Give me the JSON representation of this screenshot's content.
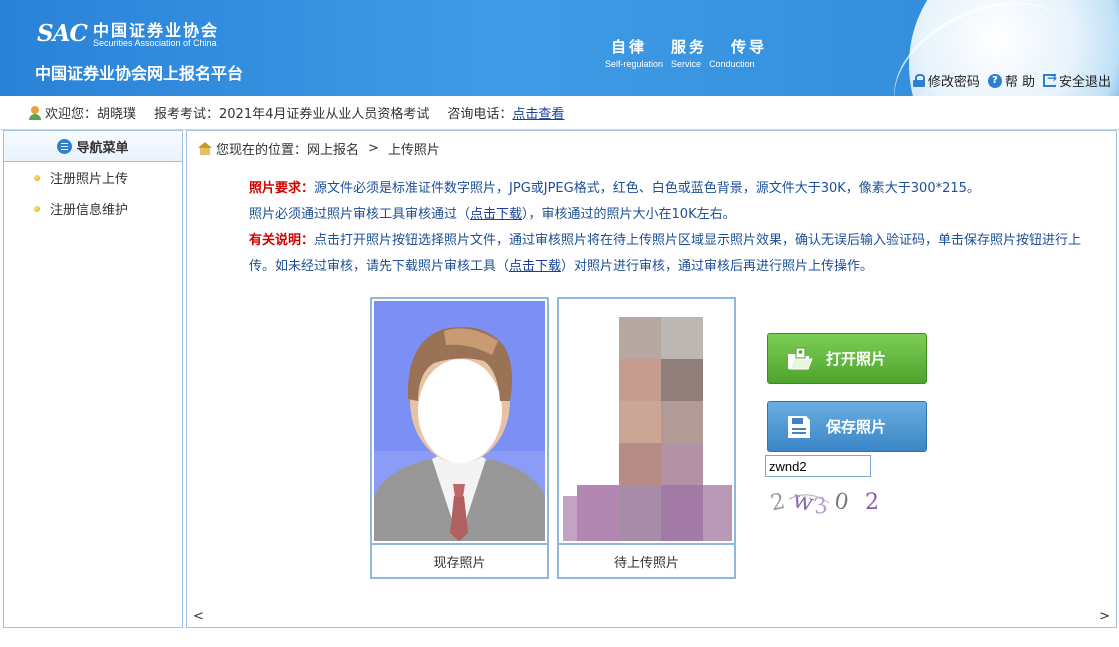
{
  "header": {
    "logo_sac": "SAC",
    "logo_cn": "中国证券业协会",
    "logo_en": "Securities Association of China",
    "platform_title": "中国证券业协会网上报名平台",
    "motto": [
      "自律",
      "服务",
      "传导"
    ],
    "motto_en": [
      "Self-regulation",
      "Service",
      "Conduction"
    ],
    "links": {
      "change_password": "修改密码",
      "help": "帮 助",
      "logout": "安全退出"
    }
  },
  "userbar": {
    "welcome": "欢迎您：胡晓璞",
    "exam": "报考考试：2021年4月证券业从业人员资格考试",
    "phone_label": "咨询电话：",
    "phone_link": "点击查看"
  },
  "sidebar": {
    "title": "导航菜单",
    "items": [
      {
        "label": "注册照片上传"
      },
      {
        "label": "注册信息维护"
      }
    ]
  },
  "breadcrumb": {
    "prefix": "您现在的位置：网上报名",
    "separator": ">",
    "current": "上传照片"
  },
  "notes": {
    "req_label": "照片要求：",
    "req_text": "源文件必须是标准证件数字照片，JPG或JPEG格式，红色、白色或蓝色背景，源文件大于30K，像素大于300*215。",
    "line2_a": "照片必须通过照片审核工具审核通过（",
    "line2_link": "点击下载",
    "line2_b": "），审核通过的照片大小在10K左右。",
    "info_label": "有关说明：",
    "info_text_a": "点击打开照片按钮选择照片文件，通过审核照片将在待上传照片区域显示照片效果，确认无误后输入验证码，单击保存照片按钮进行上传。如未经过审核，请先下载照片审核工具（",
    "info_link": "点击下载",
    "info_text_b": "）对照片进行审核，通过审核后再进行照片上传操作。"
  },
  "photos": {
    "current_caption": "现存照片",
    "pending_caption": "待上传照片"
  },
  "buttons": {
    "open": "打开照片",
    "save": "保存照片"
  },
  "captcha": {
    "value": "zwnd2",
    "chars": [
      "2",
      "w",
      "3",
      "0",
      "2"
    ]
  },
  "scroll": {
    "left": "<",
    "right": ">"
  },
  "colors": {
    "header_blue": "#2f8ad9",
    "note_blue": "#1d4f96",
    "note_red": "#d40000",
    "open_green": "#5cb43a",
    "save_blue": "#4a94d0"
  }
}
